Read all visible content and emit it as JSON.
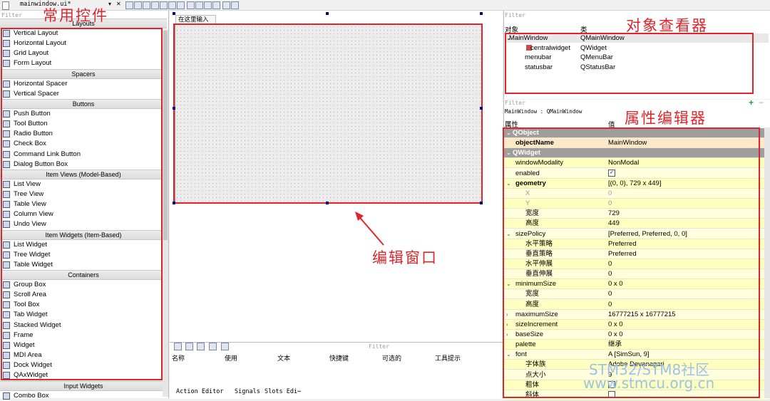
{
  "toolbar": {
    "file_tab": "mainwindow.ui*",
    "dropdown": "▾",
    "close": "✕"
  },
  "widget_box": {
    "filter_placeholder": "Filter",
    "overlay_label": "常用控件",
    "categories": [
      {
        "title": "Layouts",
        "items": [
          "Vertical Layout",
          "Horizontal Layout",
          "Grid Layout",
          "Form Layout"
        ]
      },
      {
        "title": "Spacers",
        "items": [
          "Horizontal Spacer",
          "Vertical Spacer"
        ]
      },
      {
        "title": "Buttons",
        "items": [
          "Push Button",
          "Tool Button",
          "Radio Button",
          "Check Box",
          "Command Link Button",
          "Dialog Button Box"
        ]
      },
      {
        "title": "Item Views (Model-Based)",
        "items": [
          "List View",
          "Tree View",
          "Table View",
          "Column View",
          "Undo View"
        ]
      },
      {
        "title": "Item Widgets (Item-Based)",
        "items": [
          "List Widget",
          "Tree Widget",
          "Table Widget"
        ]
      },
      {
        "title": "Containers",
        "items": [
          "Group Box",
          "Scroll Area",
          "Tool Box",
          "Tab Widget",
          "Stacked Widget",
          "Frame",
          "Widget",
          "MDI Area",
          "Dock Widget",
          "QAxWidget"
        ]
      },
      {
        "title": "Input Widgets",
        "items": [
          "Combo Box"
        ]
      }
    ]
  },
  "editor": {
    "form_tab": "在这里输入",
    "overlay_label": "编辑窗口"
  },
  "action_editor": {
    "filter_placeholder": "Filter",
    "columns": [
      "名称",
      "使用",
      "文本",
      "快捷键",
      "可选的",
      "工具提示"
    ],
    "tabs": [
      "Action Editor",
      "Signals",
      "Slots Edi⋯"
    ]
  },
  "object_inspector": {
    "filter_placeholder": "Filter",
    "overlay_label": "对象查看器",
    "headers": [
      "对象",
      "类"
    ],
    "rows": [
      {
        "name": "MainWindow",
        "class": "QMainWindow"
      },
      {
        "name": "centralwidget",
        "class": "QWidget"
      },
      {
        "name": "menubar",
        "class": "QMenuBar"
      },
      {
        "name": "statusbar",
        "class": "QStatusBar"
      }
    ]
  },
  "property_editor": {
    "filter_placeholder": "Filter",
    "context": "MainWindow : QMainWindow",
    "overlay_label": "属性编辑器",
    "headers": [
      "属性",
      "值"
    ],
    "rows": [
      {
        "name": "QObject",
        "value": "",
        "kind": "sec"
      },
      {
        "name": "objectName",
        "value": "MainWindow",
        "kind": "obj"
      },
      {
        "name": "QWidget",
        "value": "",
        "kind": "sec"
      },
      {
        "name": "windowModality",
        "value": "NonModal"
      },
      {
        "name": "enabled",
        "value": "",
        "check": true
      },
      {
        "name": "geometry",
        "value": "[(0, 0), 729 x 449]",
        "bold": true,
        "exp": "v"
      },
      {
        "name": "X",
        "value": "0",
        "ind": 1,
        "gray": true
      },
      {
        "name": "Y",
        "value": "0",
        "ind": 1,
        "gray": true
      },
      {
        "name": "宽度",
        "value": "729",
        "ind": 1
      },
      {
        "name": "高度",
        "value": "449",
        "ind": 1
      },
      {
        "name": "sizePolicy",
        "value": "[Preferred, Preferred, 0, 0]",
        "exp": "v"
      },
      {
        "name": "水平策略",
        "value": "Preferred",
        "ind": 1
      },
      {
        "name": "垂直策略",
        "value": "Preferred",
        "ind": 1
      },
      {
        "name": "水平伸展",
        "value": "0",
        "ind": 1
      },
      {
        "name": "垂直伸展",
        "value": "0",
        "ind": 1
      },
      {
        "name": "minimumSize",
        "value": "0 x 0",
        "exp": "v"
      },
      {
        "name": "宽度",
        "value": "0",
        "ind": 1
      },
      {
        "name": "高度",
        "value": "0",
        "ind": 1
      },
      {
        "name": "maximumSize",
        "value": "16777215 x 16777215",
        "exp": ">"
      },
      {
        "name": "sizeIncrement",
        "value": "0 x 0",
        "exp": ">"
      },
      {
        "name": "baseSize",
        "value": "0 x 0",
        "exp": ">"
      },
      {
        "name": "palette",
        "value": "继承"
      },
      {
        "name": "font",
        "value": "A  [SimSun, 9]",
        "exp": "v"
      },
      {
        "name": "字体族",
        "value": "Adobe Devanagari",
        "ind": 1
      },
      {
        "name": "点大小",
        "value": "9",
        "ind": 1
      },
      {
        "name": "粗体",
        "value": "",
        "ind": 1,
        "check": false
      },
      {
        "name": "斜体",
        "value": "",
        "ind": 1,
        "check": false
      }
    ]
  },
  "watermark": {
    "line1": "STM32/STM8社区",
    "line2": "www.stmcu.org.cn"
  },
  "colors": {
    "annotation_red": "#e0242c",
    "property_bg": "#ffffbf",
    "section_bg": "#9e9e9e"
  }
}
